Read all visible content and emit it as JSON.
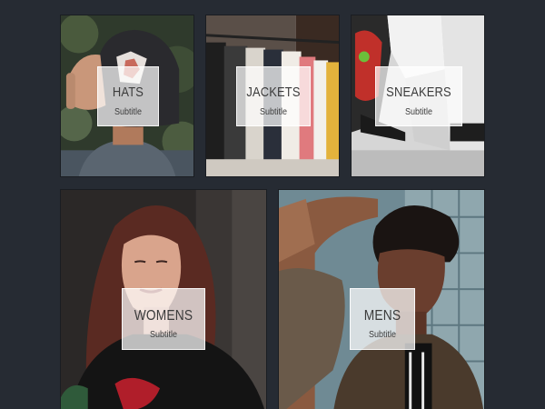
{
  "categories": [
    {
      "title": "HATS",
      "subtitle": "Subtitle"
    },
    {
      "title": "JACKETS",
      "subtitle": "Subtitle"
    },
    {
      "title": "SNEAKERS",
      "subtitle": "Subtitle"
    },
    {
      "title": "WOMENS",
      "subtitle": "Subtitle"
    },
    {
      "title": "MENS",
      "subtitle": "Subtitle"
    }
  ],
  "colors": {
    "page_background": "#262b33",
    "label_overlay": "rgba(255,255,255,0.72)",
    "label_text": "#3b3b3b"
  }
}
